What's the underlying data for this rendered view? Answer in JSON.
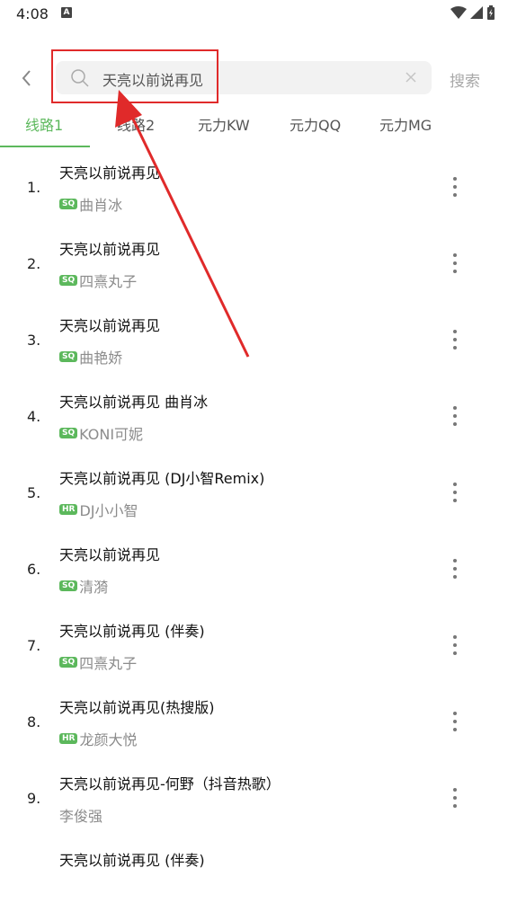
{
  "status_bar": {
    "time": "4:08",
    "notification_icon": "A"
  },
  "search": {
    "query": "天亮以前说再见",
    "button_label": "搜索"
  },
  "tabs": [
    {
      "label": "线路1",
      "active": true
    },
    {
      "label": "线路2",
      "active": false
    },
    {
      "label": "元力KW",
      "active": false
    },
    {
      "label": "元力QQ",
      "active": false
    },
    {
      "label": "元力MG",
      "active": false
    }
  ],
  "results": [
    {
      "num": "1.",
      "title": "天亮以前说再见",
      "badge": "SQ",
      "artist": "曲肖冰"
    },
    {
      "num": "2.",
      "title": "天亮以前说再见",
      "badge": "SQ",
      "artist": "四熹丸子"
    },
    {
      "num": "3.",
      "title": "天亮以前说再见",
      "badge": "SQ",
      "artist": "曲艳娇"
    },
    {
      "num": "4.",
      "title": "天亮以前说再见 曲肖冰",
      "badge": "SQ",
      "artist": "KONI可妮"
    },
    {
      "num": "5.",
      "title": "天亮以前说再见 (DJ小智Remix)",
      "badge": "HR",
      "artist": "DJ小小智"
    },
    {
      "num": "6.",
      "title": "天亮以前说再见",
      "badge": "SQ",
      "artist": "清漪"
    },
    {
      "num": "7.",
      "title": "天亮以前说再见 (伴奏)",
      "badge": "SQ",
      "artist": "四熹丸子"
    },
    {
      "num": "8.",
      "title": "天亮以前说再见(热搜版)",
      "badge": "HR",
      "artist": "龙颜大悦"
    },
    {
      "num": "9.",
      "title": "天亮以前说再见-何野（抖音热歌）",
      "badge": "",
      "artist": "李俊强"
    },
    {
      "num": "",
      "title": "天亮以前说再见 (伴奏)",
      "badge": "",
      "artist": ""
    }
  ],
  "colors": {
    "accent": "#5cb85c",
    "annotation": "#e02a2a"
  }
}
